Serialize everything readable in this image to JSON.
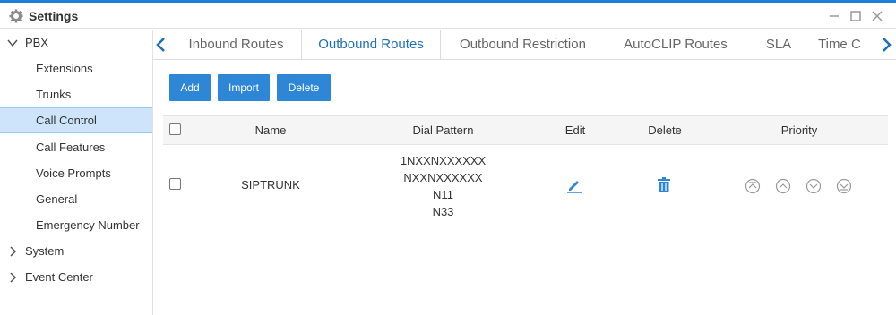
{
  "window": {
    "title": "Settings",
    "icon": "gear-icon",
    "accent_color": "#1f7fd6"
  },
  "sidebar": {
    "items": [
      {
        "label": "PBX",
        "expanded": true
      },
      {
        "label": "Extensions"
      },
      {
        "label": "Trunks"
      },
      {
        "label": "Call Control",
        "active": true
      },
      {
        "label": "Call Features"
      },
      {
        "label": "Voice Prompts"
      },
      {
        "label": "General"
      },
      {
        "label": "Emergency Number"
      },
      {
        "label": "System",
        "expanded": false
      },
      {
        "label": "Event Center",
        "expanded": false
      }
    ],
    "active_bg": "#cde4fb"
  },
  "tabs": {
    "items": [
      {
        "label": "Inbound Routes"
      },
      {
        "label": "Outbound Routes",
        "active": true
      },
      {
        "label": "Outbound Restriction"
      },
      {
        "label": "AutoCLIP Routes"
      },
      {
        "label": "SLA"
      },
      {
        "label": "Time C"
      }
    ],
    "active_color": "#1f6fb5"
  },
  "toolbar": {
    "add_label": "Add",
    "import_label": "Import",
    "delete_label": "Delete",
    "button_color": "#2e86d6"
  },
  "table": {
    "headers": {
      "name": "Name",
      "dial_pattern": "Dial Pattern",
      "edit": "Edit",
      "delete": "Delete",
      "priority": "Priority"
    },
    "rows": [
      {
        "name": "SIPTRUNK",
        "dial_pattern": [
          "1NXXNXXXXXX",
          "NXXNXXXXXX",
          "N11",
          "N33"
        ],
        "edit_icon": "pencil-icon",
        "delete_icon": "trash-icon",
        "priority_icons": [
          "move-top-icon",
          "move-up-icon",
          "move-down-icon",
          "move-bottom-icon"
        ]
      }
    ]
  }
}
